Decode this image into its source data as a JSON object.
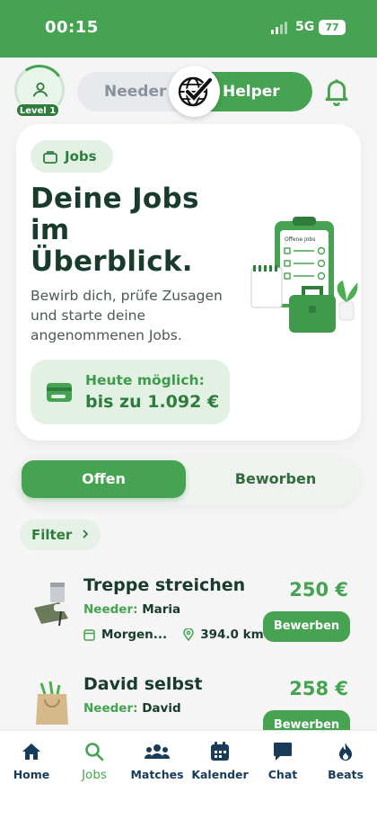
{
  "status_bar": {
    "time": "00:15",
    "network": "5G",
    "battery": "77"
  },
  "header": {
    "level": "Level 1",
    "role_toggle": {
      "left": "Needer",
      "right": "Helper",
      "active": "Helper"
    }
  },
  "hero": {
    "chip": "Jobs",
    "title": "Deine Jobs im Überblick.",
    "subtitle": "Bewirb dich, prüfe Zusagen und starte deine angenommenen Jobs.",
    "earnings_label": "Heute möglich:",
    "earnings_value": "bis zu 1.092 €",
    "illustration_text": "Offene Jobs"
  },
  "tabs": {
    "open": "Offen",
    "applied": "Beworben",
    "active": "Offen"
  },
  "filter_label": "Filter",
  "jobs": [
    {
      "title": "Treppe streichen",
      "needer_label": "Needer:",
      "needer_name": "Maria",
      "date": "Morgen...",
      "distance": "394.0 km",
      "price": "250 €",
      "action": "Bewerben"
    },
    {
      "title": "David selbst",
      "needer_label": "Needer:",
      "needer_name": "David",
      "date": "",
      "distance": "",
      "price": "258 €",
      "action": "Bewerben"
    }
  ],
  "bottom_nav": [
    {
      "label": "Home",
      "icon": "home-icon"
    },
    {
      "label": "Jobs",
      "icon": "search-icon"
    },
    {
      "label": "Matches",
      "icon": "people-icon"
    },
    {
      "label": "Kalender",
      "icon": "calendar-icon"
    },
    {
      "label": "Chat",
      "icon": "chat-icon"
    },
    {
      "label": "Beats",
      "icon": "flame-icon"
    }
  ],
  "active_nav": "Jobs",
  "colors": {
    "brand": "#45a352",
    "dark_text": "#183b2c",
    "nav_text": "#183b5a"
  }
}
